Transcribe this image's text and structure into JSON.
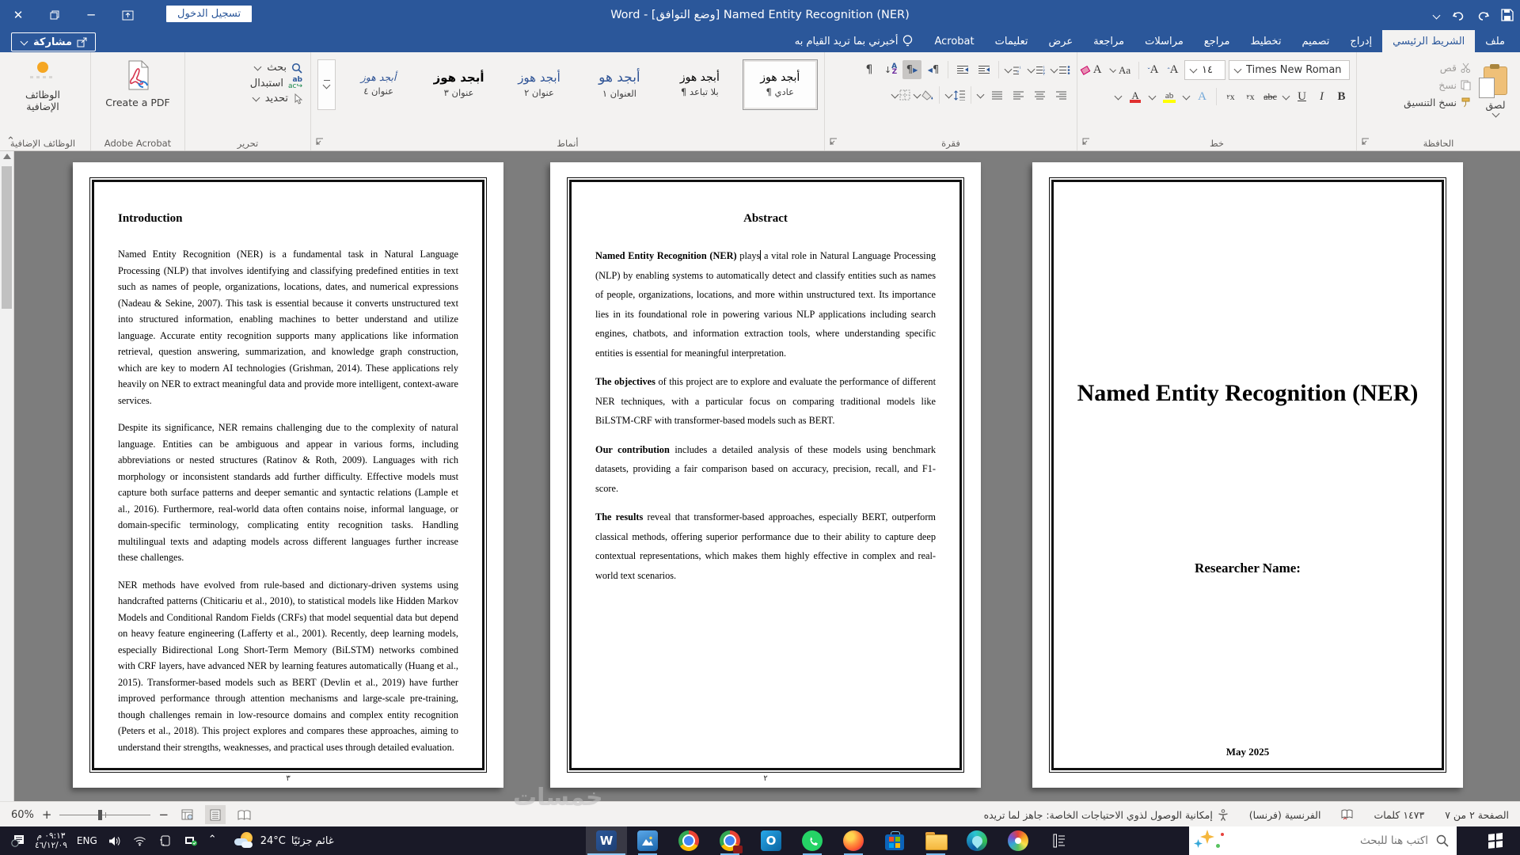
{
  "titlebar": {
    "title": "Word  -  [وضع التوافق] Named Entity Recognition (NER)",
    "signin": "تسجيل الدخول"
  },
  "share": {
    "label": "مشاركة"
  },
  "tabs": [
    {
      "label": "ملف"
    },
    {
      "label": "الشريط الرئيسي"
    },
    {
      "label": "إدراج"
    },
    {
      "label": "تصميم"
    },
    {
      "label": "تخطيط"
    },
    {
      "label": "مراجع"
    },
    {
      "label": "مراسلات"
    },
    {
      "label": "مراجعة"
    },
    {
      "label": "عرض"
    },
    {
      "label": "تعليمات"
    },
    {
      "label": "Acrobat"
    }
  ],
  "tell_me": "أخبرني بما تريد القيام به",
  "ribbon": {
    "clipboard": {
      "label": "الحافظة",
      "paste": "لصق",
      "cut": "قص",
      "copy": "نسخ",
      "format_painter": "نسخ التنسيق"
    },
    "font": {
      "label": "خط",
      "family": "Times New Roman",
      "size": "١٤"
    },
    "paragraph": {
      "label": "فقرة"
    },
    "styles": {
      "label": "أنماط",
      "items": [
        {
          "preview": "أبجد هوز",
          "name": "عادي ¶"
        },
        {
          "preview": "أبجد هوز",
          "name": "بلا تباعد ¶"
        },
        {
          "preview": "أبجد هو",
          "name": "العنوان ١"
        },
        {
          "preview": "أبجد هوز",
          "name": "عنوان ٢"
        },
        {
          "preview": "أبجد هوز",
          "name": "عنوان ٣"
        },
        {
          "preview": "أبجد هوز",
          "name": "عنوان ٤"
        }
      ]
    },
    "editing": {
      "label": "تحرير",
      "find": "بحث",
      "replace": "استبدال",
      "select": "تحديد"
    },
    "acrobat": {
      "label": "Adobe Acrobat",
      "button": "Create a PDF"
    },
    "addins": {
      "label": "الوظائف الإضافية",
      "button": "الوظائف الإضافية"
    }
  },
  "document": {
    "intro": {
      "heading": "Introduction",
      "paragraphs": [
        "Named Entity Recognition (NER) is a fundamental task in Natural Language Processing (NLP) that involves identifying and classifying predefined entities in text such as names of people, organizations, locations, dates, and numerical expressions (Nadeau & Sekine, 2007). This task is essential because it converts unstructured text into structured information, enabling machines to better understand and utilize language. Accurate entity recognition supports many applications like information retrieval, question answering, summarization, and knowledge graph construction, which are key to modern AI technologies (Grishman, 2014). These applications rely heavily on NER to extract meaningful data and provide more intelligent, context-aware services.",
        "Despite its significance, NER remains challenging due to the complexity of natural language. Entities can be ambiguous and appear in various forms, including abbreviations or nested structures (Ratinov & Roth, 2009). Languages with rich morphology or inconsistent standards add further difficulty. Effective models must capture both surface patterns and deeper semantic and syntactic relations (Lample et al., 2016). Furthermore, real-world data often contains noise, informal language, or domain-specific terminology, complicating entity recognition tasks. Handling multilingual texts and adapting models across different languages further increase these challenges.",
        "NER methods have evolved from rule-based and dictionary-driven systems using handcrafted patterns (Chiticariu et al., 2010), to statistical models like Hidden Markov Models and Conditional Random Fields (CRFs) that model sequential data but depend on heavy feature engineering (Lafferty et al., 2001). Recently, deep learning models, especially Bidirectional Long Short-Term Memory (BiLSTM) networks combined with CRF layers, have advanced NER by learning features automatically (Huang et al., 2015). Transformer-based models such as BERT (Devlin et al., 2019) have further improved performance through attention mechanisms and large-scale pre-training, though challenges remain in low-resource domains and complex entity recognition (Peters et al., 2018). This project explores and compares these approaches, aiming to understand their strengths, weaknesses, and practical uses through detailed evaluation."
      ],
      "footer": "٣"
    },
    "abstract": {
      "heading": "Abstract",
      "p1_lead": "Named Entity Recognition (NER)",
      "p1_before_cursor": " plays",
      "p1_after_cursor": " a vital role in Natural Language Processing (NLP) by enabling systems to automatically detect and classify entities such as names of people, organizations, locations, and more within unstructured text. Its importance lies in its foundational role in powering various NLP applications including search engines, chatbots, and information extraction tools, where understanding specific entities is essential for meaningful interpretation.",
      "p2_lead": "The objectives",
      "p2_rest": " of this project are to explore and evaluate the performance of different NER techniques, with a particular focus on comparing traditional models like BiLSTM-CRF with transformer-based models such as BERT.",
      "p3_lead": "Our contribution",
      "p3_rest": " includes a detailed analysis of these models using benchmark datasets, providing a fair comparison based on accuracy, precision, recall, and F1-score.",
      "p4_lead": "The results",
      "p4_rest": " reveal that transformer-based approaches, especially BERT, outperform classical methods, offering superior performance due to their ability to capture deep contextual representations, which makes them highly effective in complex and real-world text scenarios.",
      "footer": "٢"
    },
    "title_page": {
      "title": "Named Entity Recognition (NER)",
      "researcher": "Researcher Name:",
      "date": "May 2025"
    }
  },
  "statusbar": {
    "zoom": "60%",
    "page": "الصفحة ٢ من ٧",
    "words": "١٤٧٣ كلمات",
    "language": "الفرنسية (فرنسا)",
    "accessibility": "إمكانية الوصول لذوي الاحتياجات الخاصة: جاهز لما تريده"
  },
  "taskbar": {
    "time": "٠٩:١٣ م",
    "date": "٤٦/١٢/٠٩",
    "lang": "ENG",
    "temperature": "24°C",
    "weather": "غائم جزئيًا",
    "search_placeholder": "اكتب هنا للبحث",
    "apps": [
      "word",
      "photos",
      "chrome",
      "chrome-media",
      "outlook",
      "whatsapp",
      "firefox",
      "store",
      "file-explorer",
      "edge",
      "pinwheel",
      "notes"
    ]
  },
  "watermark": "خمسات",
  "colors": {
    "accent": "#2b579a",
    "run_indicator": "#76b9ed",
    "doc_background": "#7d7d7d"
  }
}
